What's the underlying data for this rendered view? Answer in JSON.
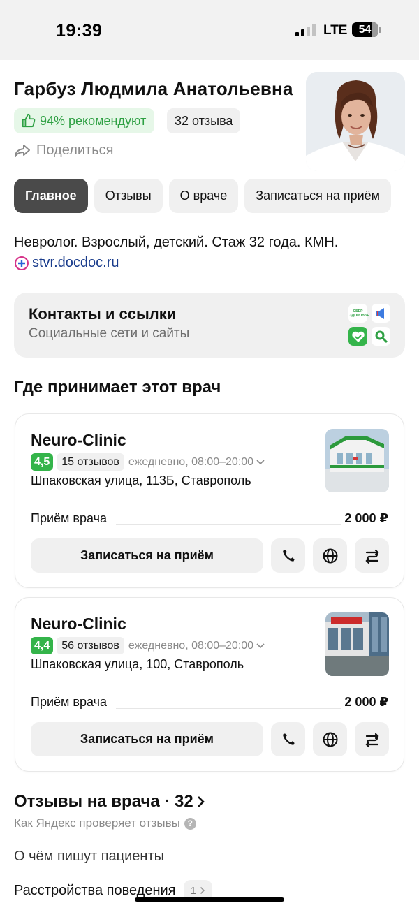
{
  "status_bar": {
    "time": "19:39",
    "network": "LTE",
    "battery": "54"
  },
  "doctor": {
    "name": "Гарбуз Людмила Анатольевна",
    "recommend": "94% рекомендуют",
    "reviews_count": "32 отзыва",
    "share": "Поделиться",
    "specialty": "Невролог. Взрослый, детский. Стаж 32 года. КМН.",
    "site": "stvr.docdoc.ru"
  },
  "tabs": [
    {
      "label": "Главное",
      "active": true
    },
    {
      "label": "Отзывы",
      "active": false
    },
    {
      "label": "О враче",
      "active": false
    },
    {
      "label": "Записаться на приём",
      "active": false
    }
  ],
  "contacts": {
    "title": "Контакты и ссылки",
    "subtitle": "Социальные сети и сайты",
    "icon_top_left_text": "СБЕР ЗДОРОВЬЕ",
    "icons": [
      "sber-health-icon",
      "megaphone-icon",
      "heart-check-icon",
      "search-icon"
    ]
  },
  "clinics_section_title": "Где принимает этот врач",
  "clinics": [
    {
      "name": "Neuro-Clinic",
      "rating": "4,5",
      "reviews": "15 отзывов",
      "hours": "ежедневно, 08:00–20:00",
      "address": "Шпаковская улица, 113Б, Ставрополь",
      "price_label": "Приём врача",
      "price": "2 000 ₽",
      "book": "Записаться на приём"
    },
    {
      "name": "Neuro-Clinic",
      "rating": "4,4",
      "reviews": "56 отзывов",
      "hours": "ежедневно, 08:00–20:00",
      "address": "Шпаковская улица, 100, Ставрополь",
      "price_label": "Приём врача",
      "price": "2 000 ₽",
      "book": "Записаться на приём"
    }
  ],
  "reviews": {
    "title": "Отзывы на врача · 32",
    "check": "Как Яндекс проверяет отзывы",
    "help_glyph": "?",
    "topics_title": "О чём пишут пациенты",
    "topic": "Расстройства поведения",
    "topic_count": "1"
  },
  "colors": {
    "accent_green": "#34b44a",
    "link_blue": "#1a3c8c",
    "tab_active": "#4a4a4a"
  }
}
